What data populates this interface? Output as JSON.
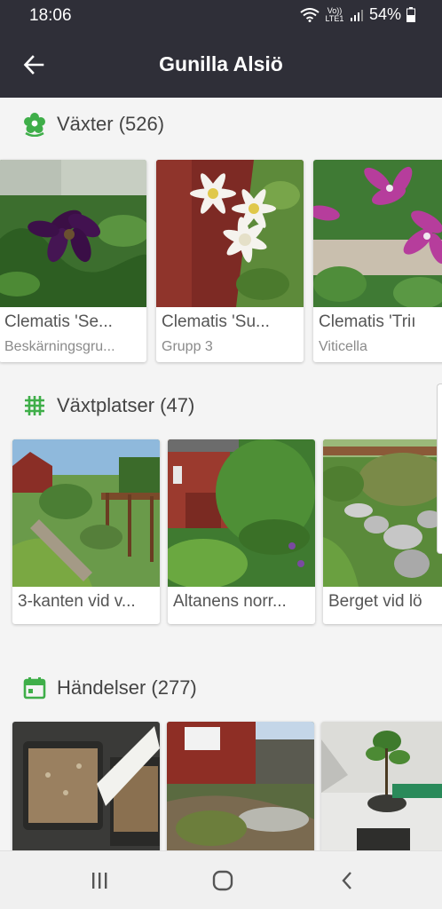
{
  "status_bar": {
    "time": "18:06",
    "network": "Vo)) LTE1",
    "battery": "54%"
  },
  "app_bar": {
    "title": "Gunilla Alsiö"
  },
  "sections": {
    "plants": {
      "title": "Växter (526)",
      "cards": [
        {
          "title": "Clematis 'Se...",
          "subtitle": "Beskärningsgru..."
        },
        {
          "title": "Clematis 'Su...",
          "subtitle": "Grupp 3"
        },
        {
          "title": "Clematis 'Triı",
          "subtitle": "Viticella"
        }
      ]
    },
    "places": {
      "title": "Växtplatser (47)",
      "cards": [
        {
          "title": "3-kanten vid v..."
        },
        {
          "title": "Altanens norr..."
        },
        {
          "title": "Berget vid lö"
        }
      ]
    },
    "events": {
      "title": "Händelser (277)"
    }
  },
  "colors": {
    "accent": "#3fae49",
    "bar": "#2f2f38"
  }
}
